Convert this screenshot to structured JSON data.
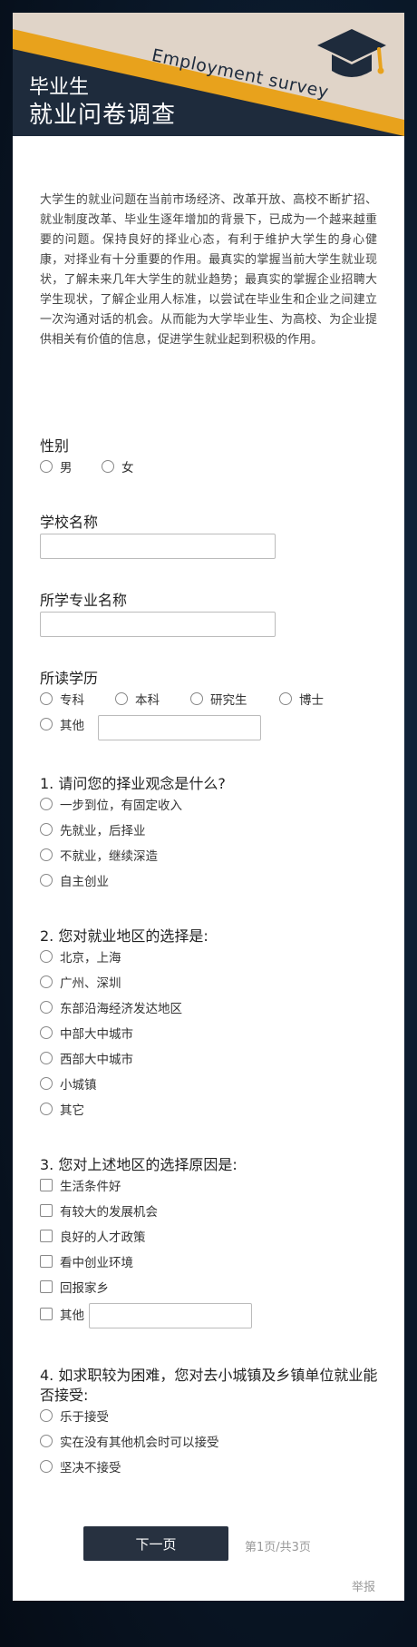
{
  "header": {
    "subtitle_en": "Employment survey",
    "title_line1": "毕业生",
    "title_line2": "就业问卷调查",
    "colors": {
      "accent": "#e8a21c",
      "band": "#e0d4c8",
      "dark": "#1e2b3c"
    }
  },
  "intro": "大学生的就业问题在当前市场经济、改革开放、高校不断扩招、就业制度改革、毕业生逐年增加的背景下，已成为一个越来越重要的问题。保持良好的择业心态，有利于维护大学生的身心健康，对择业有十分重要的作用。最真实的掌握当前大学生就业现状，了解未来几年大学生的就业趋势；最真实的掌握企业招聘大学生现状，了解企业用人标准，以尝试在毕业生和企业之间建立一次沟通对话的机会。从而能为大学毕业生、为高校、为企业提供相关有价值的信息，促进学生就业起到积极的作用。",
  "gender": {
    "label": "性别",
    "options": [
      "男",
      "女"
    ]
  },
  "school": {
    "label": "学校名称",
    "value": ""
  },
  "major": {
    "label": "所学专业名称",
    "value": ""
  },
  "education": {
    "label": "所读学历",
    "options": [
      "专科",
      "本科",
      "研究生",
      "博士",
      "其他"
    ]
  },
  "q1": {
    "label": "1. 请问您的择业观念是什么?",
    "options": [
      "一步到位，有固定收入",
      "先就业，后择业",
      "不就业，继续深造",
      "自主创业"
    ]
  },
  "q2": {
    "label": "2. 您对就业地区的选择是:",
    "options": [
      "北京，上海",
      "广州、深圳",
      "东部沿海经济发达地区",
      "中部大中城市",
      "西部大中城市",
      "小城镇",
      "其它"
    ]
  },
  "q3": {
    "label": "3. 您对上述地区的选择原因是:",
    "options": [
      "生活条件好",
      "有较大的发展机会",
      "良好的人才政策",
      "看中创业环境",
      "回报家乡",
      "其他"
    ]
  },
  "q4": {
    "label_line1": "4. 如求职较为困难，您对去小城镇及乡镇单位就业能",
    "label_line2": "否接受:",
    "options": [
      "乐于接受",
      "实在没有其他机会时可以接受",
      "坚决不接受"
    ]
  },
  "footer": {
    "next_label": "下一页",
    "page_info": "第1页/共3页",
    "report_label": "举报"
  }
}
